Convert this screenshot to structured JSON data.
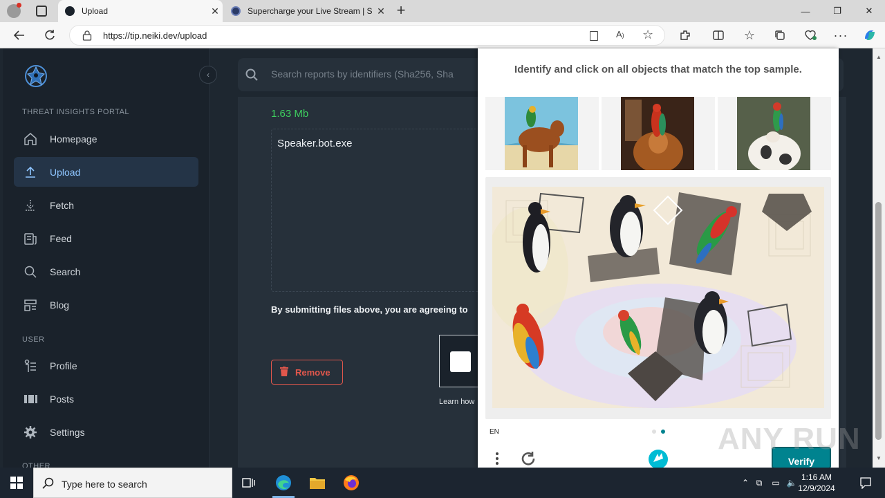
{
  "browser": {
    "tabs": [
      {
        "title": "Upload",
        "close": "✕"
      },
      {
        "title": "Supercharge your Live Stream | S",
        "close": "✕"
      }
    ],
    "new_tab": "+",
    "window_controls": {
      "minimize": "—",
      "restore": "❐",
      "close": "✕"
    },
    "url": "https://tip.neiki.dev/upload"
  },
  "sidebar": {
    "collapse_icon": "‹",
    "section_portal": "THREAT INSIGHTS PORTAL",
    "items": [
      {
        "label": "Homepage",
        "icon": "home-icon"
      },
      {
        "label": "Upload",
        "icon": "upload-icon",
        "active": true
      },
      {
        "label": "Fetch",
        "icon": "download-icon"
      },
      {
        "label": "Feed",
        "icon": "feed-icon"
      },
      {
        "label": "Search",
        "icon": "search-icon"
      },
      {
        "label": "Blog",
        "icon": "blog-icon"
      }
    ],
    "section_user": "USER",
    "user_items": [
      {
        "label": "Profile",
        "icon": "profile-icon"
      },
      {
        "label": "Posts",
        "icon": "posts-icon"
      },
      {
        "label": "Settings",
        "icon": "gear-icon"
      }
    ],
    "section_other": "OTHER"
  },
  "search": {
    "placeholder": "Search reports by identifiers (Sha256, Sha"
  },
  "upload": {
    "file_size": "1.63 Mb",
    "file_name": "Speaker.bot.exe",
    "agreement": "By submitting files above, you are agreeing to",
    "remove_label": "Remove",
    "learn_text": "Learn how"
  },
  "captcha": {
    "prompt": "Identify and click on all objects that match the top sample.",
    "language": "EN",
    "verify_label": "Verify"
  },
  "watermark": "ANY RUN",
  "taskbar": {
    "search_placeholder": "Type here to search",
    "time": "1:16 AM",
    "date": "12/9/2024"
  },
  "colors": {
    "accent": "#8ec5ff",
    "success": "#3ecf5f",
    "danger": "#e2574c",
    "verify": "#00838f"
  }
}
